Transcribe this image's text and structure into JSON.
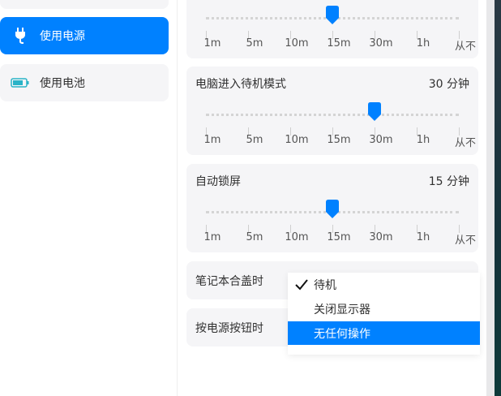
{
  "sidebar": {
    "items": [
      {
        "label": "使用电源",
        "icon": "power-plug-icon",
        "active": true
      },
      {
        "label": "使用电池",
        "icon": "battery-icon",
        "active": false
      }
    ]
  },
  "slider_tick_labels": [
    "1m",
    "5m",
    "10m",
    "15m",
    "30m",
    "1h",
    "从不"
  ],
  "cards": [
    {
      "title": "",
      "value": "",
      "selected_index": 3
    },
    {
      "title": "电脑进入待机模式",
      "value": "30 分钟",
      "selected_index": 4
    },
    {
      "title": "自动锁屏",
      "value": "15 分钟",
      "selected_index": 3
    }
  ],
  "lid_row": {
    "title": "笔记本合盖时"
  },
  "power_button_row": {
    "title": "按电源按钮时"
  },
  "menu": {
    "items": [
      {
        "label": "待机",
        "checked": true,
        "highlighted": false
      },
      {
        "label": "关闭显示器",
        "checked": false,
        "highlighted": false
      },
      {
        "label": "无任何操作",
        "checked": false,
        "highlighted": true
      }
    ]
  },
  "colors": {
    "accent": "#0081ff",
    "card_bg": "#f5f5f7"
  }
}
